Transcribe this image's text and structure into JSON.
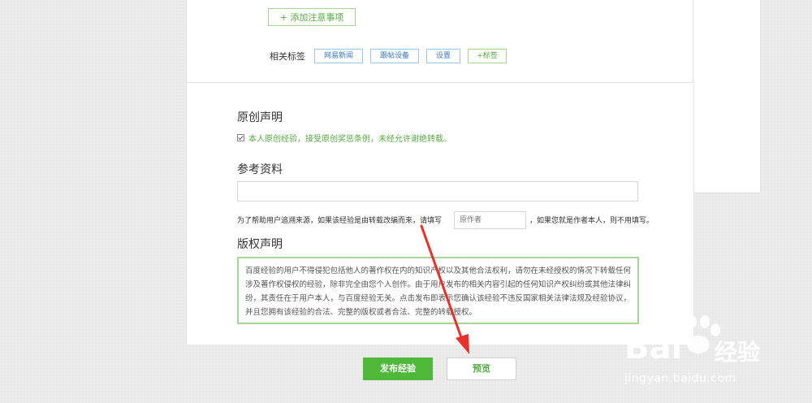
{
  "add_note_button": "+ 添加注意事项",
  "tags": {
    "label": "相关标签",
    "items": [
      "网易新闻",
      "跟帖设备",
      "设置"
    ],
    "add_label": "+标签"
  },
  "original": {
    "title": "原创声明",
    "statement": "本人原创经验，接受原创奖惩条例，未经允许谢绝转载。"
  },
  "reference": {
    "title": "参考资料",
    "input_value": "",
    "help_prefix": "为了帮助用户追溯来源，如果该经验是由转载改编而来，请填写",
    "author_placeholder": "原作者",
    "help_suffix": "，如果您就是作者本人，则不用填写。"
  },
  "copyright": {
    "title": "版权声明",
    "text": "百度经验的用户不得侵犯包括他人的著作权在内的知识产权以及其他合法权利，请勿在未经授权的情况下转载任何涉及著作权侵权的经验，除非完全由您个人创作。由于用户发布的相关内容引起的任何知识产权纠纷或其他法律纠纷，其责任在于用户本人，与百度经验无关。点击发布即表示您确认该经验不违反国家相关法律法规及经验协议，并且您拥有该经验的合法、完整的版权或者合法、完整的转载授权。"
  },
  "actions": {
    "publish": "发布经验",
    "preview": "预览"
  },
  "watermark": {
    "brand": "Bai",
    "brand_cn": "经验",
    "url": "jingyan.baidu.com"
  },
  "colors": {
    "accent_green": "#4fb838",
    "annotation_red": "#e8312a"
  }
}
